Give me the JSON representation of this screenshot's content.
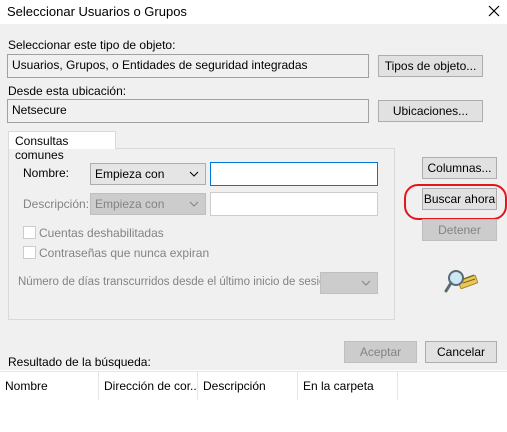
{
  "window": {
    "title": "Seleccionar Usuarios o Grupos"
  },
  "object_type": {
    "label": "Seleccionar este tipo de objeto:",
    "value": "Usuarios, Grupos, o Entidades de seguridad integradas",
    "button": "Tipos de objeto..."
  },
  "location": {
    "label": "Desde esta ubicación:",
    "value": "Netsecure",
    "button": "Ubicaciones..."
  },
  "query": {
    "tab_label": "Consultas comunes",
    "name_label": "Nombre:",
    "name_mode": "Empieza con",
    "name_value": "",
    "description_label": "Descripción:",
    "description_mode": "Empieza con",
    "description_value": "",
    "checkbox_disabled_accounts": "Cuentas deshabilitadas",
    "checkbox_non_expiring_passwords": "Contraseñas que nunca expiran",
    "days_label": "Número de días transcurridos desde el último inicio de sesión:",
    "days_value": ""
  },
  "side_buttons": {
    "columns": "Columnas...",
    "search_now": "Buscar ahora",
    "stop": "Detener"
  },
  "footer": {
    "accept": "Aceptar",
    "cancel": "Cancelar"
  },
  "results": {
    "label": "Resultado de la búsqueda:",
    "columns": [
      "Nombre",
      "Dirección de cor...",
      "Descripción",
      "En la carpeta"
    ]
  },
  "colors": {
    "highlight": "#e3161d",
    "focus": "#0078d7",
    "panel": "#f0f0f0"
  }
}
